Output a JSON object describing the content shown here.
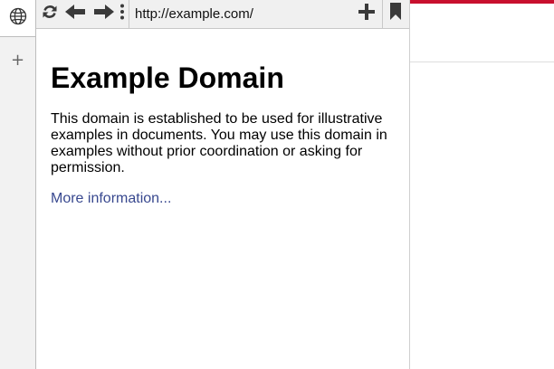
{
  "colors": {
    "accent": "#c8102e",
    "link": "#38488f",
    "toolbar_bg": "#f0f0f0",
    "tab_strip_bg": "#f2f2f2"
  },
  "tab_strip": {
    "active_tab_icon": "globe-icon",
    "new_tab_label": "+"
  },
  "toolbar": {
    "buttons": [
      "reload-icon",
      "back-arrow-icon",
      "forward-arrow-icon",
      "more-vertical-icon"
    ],
    "url": "http://example.com/",
    "add_bookmark_icon": "plus-icon",
    "bookmarks_icon": "bookmark-icon"
  },
  "page": {
    "title": "Example Domain",
    "paragraph": "This domain is established to be used for illustrative examples in documents. You may use this domain in examples without prior coordination or asking for permission.",
    "link_text": "More information..."
  }
}
